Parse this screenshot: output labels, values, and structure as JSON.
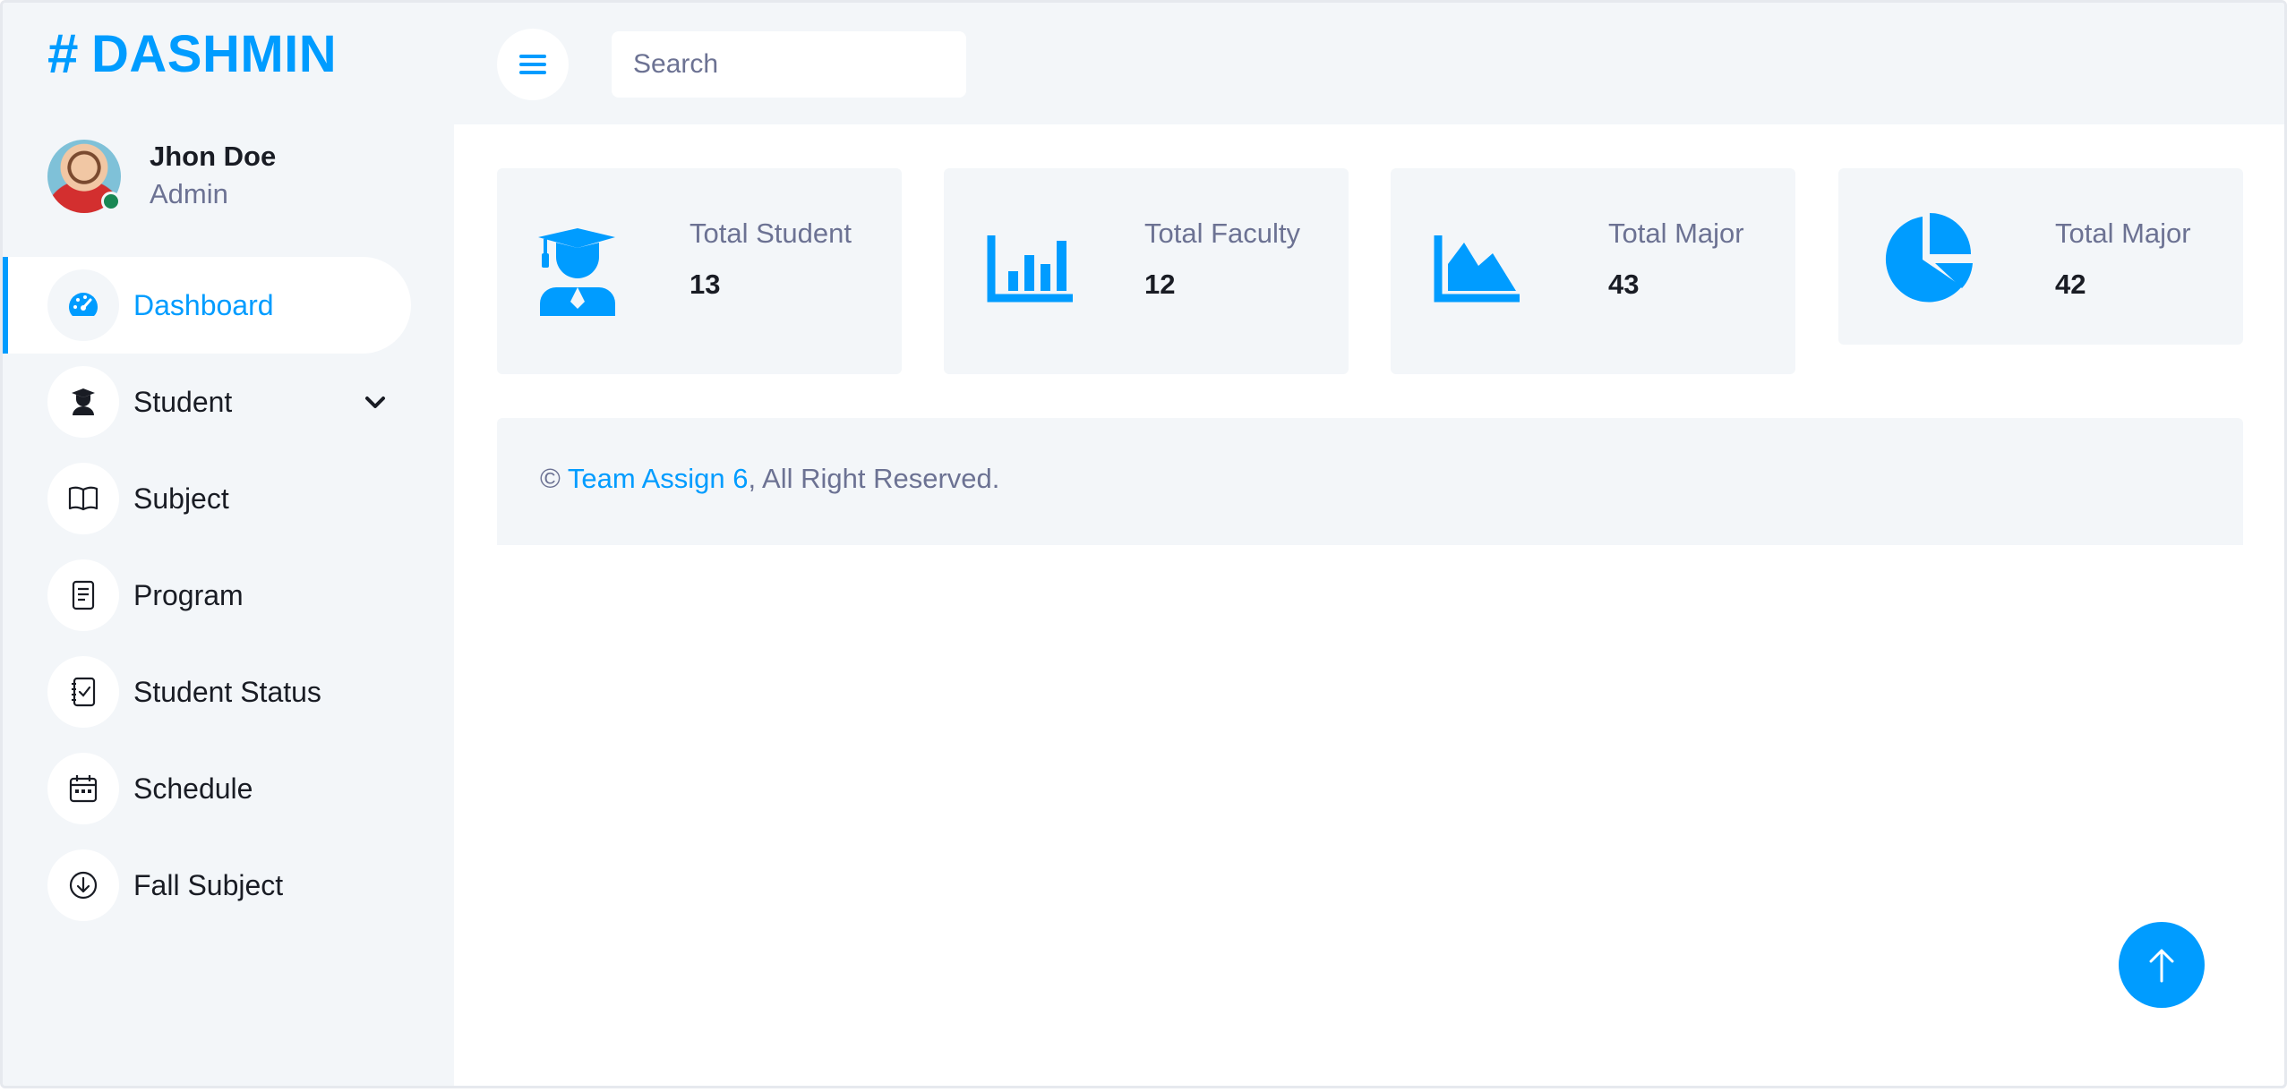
{
  "brand": {
    "hash": "#",
    "name": "DASHMIN"
  },
  "profile": {
    "name": "Jhon Doe",
    "role": "Admin"
  },
  "sidebar": {
    "items": [
      {
        "label": "Dashboard",
        "icon": "speedometer-icon",
        "active": true
      },
      {
        "label": "Student",
        "icon": "graduate-icon",
        "has_dropdown": true
      },
      {
        "label": "Subject",
        "icon": "book-icon"
      },
      {
        "label": "Program",
        "icon": "document-icon"
      },
      {
        "label": "Student Status",
        "icon": "checklist-icon"
      },
      {
        "label": "Schedule",
        "icon": "calendar-icon"
      },
      {
        "label": "Fall Subject",
        "icon": "arrow-down-circle-icon"
      }
    ]
  },
  "topbar": {
    "search_placeholder": "Search"
  },
  "stats": [
    {
      "label": "Total Student",
      "value": "13",
      "icon": "graduate-icon"
    },
    {
      "label": "Total Faculty",
      "value": "12",
      "icon": "bar-chart-icon"
    },
    {
      "label": "Total Major",
      "value": "43",
      "icon": "area-chart-icon"
    },
    {
      "label": "Total Major",
      "value": "42",
      "icon": "pie-chart-icon"
    }
  ],
  "footer": {
    "copyright": "©",
    "link_text": "Team Assign 6",
    "suffix": ", All Right Reserved."
  },
  "colors": {
    "accent": "#009cff",
    "panel": "#f3f6f9",
    "text": "#191c24",
    "muted": "#6c7293",
    "online": "#198754"
  }
}
